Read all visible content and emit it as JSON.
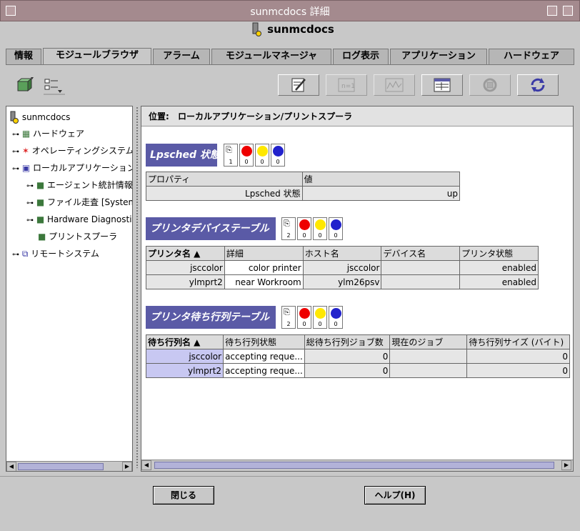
{
  "window": {
    "title": "sunmcdocs 詳細"
  },
  "header": {
    "name": "sunmcdocs"
  },
  "tabs": [
    {
      "label": "情報"
    },
    {
      "label": "モジュールブラウザ"
    },
    {
      "label": "アラーム"
    },
    {
      "label": "モジュールマネージャ"
    },
    {
      "label": "ログ表示"
    },
    {
      "label": "アプリケーション"
    },
    {
      "label": "ハードウェア"
    }
  ],
  "tree": {
    "root": "sunmcdocs",
    "items": [
      {
        "label": "ハードウェア"
      },
      {
        "label": "オペレーティングシステム"
      },
      {
        "label": "ローカルアプリケーション"
      },
      {
        "label": "エージェント統計情報"
      },
      {
        "label": "ファイル走査 [System"
      },
      {
        "label": "Hardware Diagnostic"
      },
      {
        "label": "プリントスプーラ"
      },
      {
        "label": "リモートシステム"
      }
    ]
  },
  "location": {
    "label": "位置:",
    "path": "ローカルアプリケーション/プリントスプーラ"
  },
  "lpsched": {
    "title": "Lpsched 状態",
    "counts": [
      "1",
      "0",
      "0",
      "0"
    ],
    "headers": [
      "プロパティ",
      "値"
    ],
    "rows": [
      [
        "Lpsched 状態",
        "up"
      ]
    ]
  },
  "printers": {
    "title": "プリンタデバイステーブル",
    "counts": [
      "2",
      "0",
      "0",
      "0"
    ],
    "headers": [
      "プリンタ名 ▲",
      "詳細",
      "ホスト名",
      "デバイス名",
      "プリンタ状態"
    ],
    "rows": [
      [
        "jsccolor",
        "color printer",
        "jsccolor",
        "",
        "enabled"
      ],
      [
        "ylmprt2",
        "near Workroom",
        "ylm26psv",
        "",
        "enabled"
      ]
    ]
  },
  "queues": {
    "title": "プリンタ待ち行列テーブル",
    "counts": [
      "2",
      "0",
      "0",
      "0"
    ],
    "headers": [
      "待ち行列名 ▲",
      "待ち行列状態",
      "総待ち行列ジョブ数",
      "現在のジョブ",
      "待ち行列サイズ (バイト)"
    ],
    "rows": [
      [
        "jsccolor",
        "accepting reque...",
        "0",
        "",
        "0"
      ],
      [
        "ylmprt2",
        "accepting reque...",
        "0",
        "",
        "0"
      ]
    ]
  },
  "buttons": {
    "close": "閉じる",
    "help": "ヘルプ(H)"
  },
  "colors": {
    "accent": "#5a5aa6",
    "titlebar": "#a48a8e",
    "selection": "#c8c8f2"
  }
}
